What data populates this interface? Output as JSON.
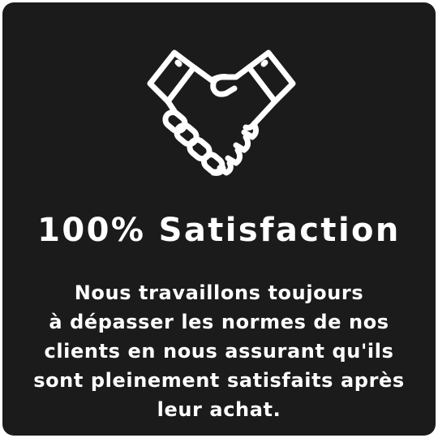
{
  "card": {
    "icon": "handshake-icon",
    "title": "100% Satisfaction",
    "description_lines": [
      "Nous travaillons toujours",
      "à dépasser les normes de nos",
      "clients en nous assurant qu'ils",
      "sont pleinement satisfaits après",
      "leur achat."
    ]
  },
  "colors": {
    "background": "#1c1b1b",
    "text": "#ffffff",
    "icon_stroke": "#ffffff"
  }
}
